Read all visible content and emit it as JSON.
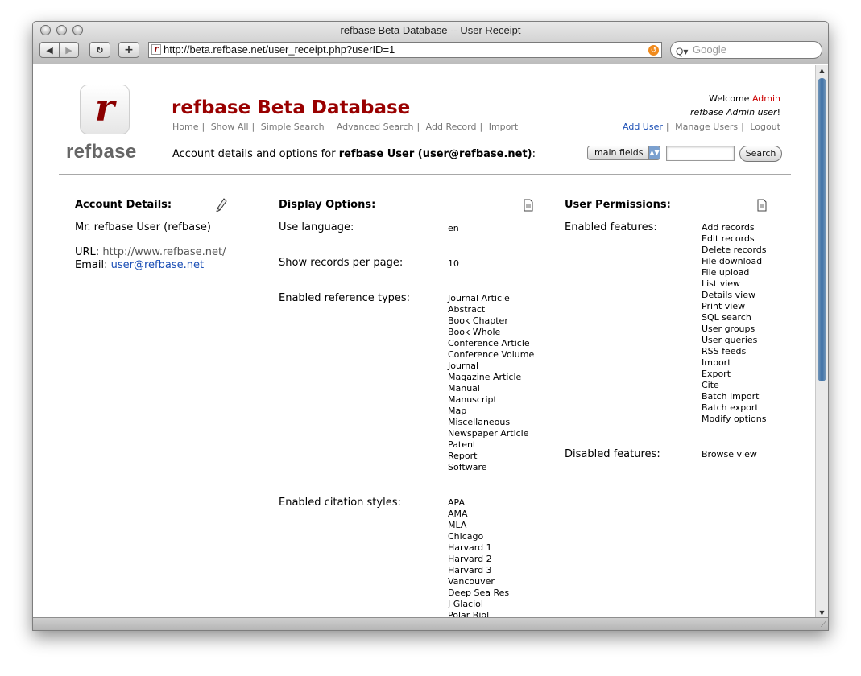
{
  "window": {
    "title": "refbase Beta Database -- User Receipt",
    "url": "http://beta.refbase.net/user_receipt.php?userID=1",
    "search_placeholder": "Google"
  },
  "header": {
    "logo_word": "refbase",
    "site_title": "refbase Beta Database",
    "nav": [
      "Home",
      "Show All",
      "Simple Search",
      "Advanced Search",
      "Add Record",
      "Import"
    ],
    "account_prefix": "Account details and options for ",
    "account_user": "refbase User (user@refbase.net)",
    "account_suffix": ":",
    "welcome_prefix": "Welcome ",
    "welcome_name": "Admin",
    "user_role": "refbase Admin user",
    "user_role_suffix": "!",
    "admin_nav": [
      "Add User",
      "Manage Users",
      "Logout"
    ],
    "search_field_select": "main fields",
    "search_button": "Search"
  },
  "account": {
    "heading": "Account Details:",
    "name": "Mr. refbase User (refbase)",
    "url_label": "URL:",
    "url_value": "http://www.refbase.net/",
    "email_label": "Email:",
    "email_value": "user@refbase.net"
  },
  "display": {
    "heading": "Display Options:",
    "language_label": "Use language:",
    "language_value": "en",
    "records_label": "Show records per page:",
    "records_value": "10",
    "ref_types_label": "Enabled reference types:",
    "ref_types": [
      "Journal Article",
      "Abstract",
      "Book Chapter",
      "Book Whole",
      "Conference Article",
      "Conference Volume",
      "Journal",
      "Magazine Article",
      "Manual",
      "Manuscript",
      "Map",
      "Miscellaneous",
      "Newspaper Article",
      "Patent",
      "Report",
      "Software"
    ],
    "citation_label": "Enabled citation styles:",
    "citation_styles": [
      "APA",
      "AMA",
      "MLA",
      "Chicago",
      "Harvard 1",
      "Harvard 2",
      "Harvard 3",
      "Vancouver",
      "Deep Sea Res",
      "J Glaciol",
      "Polar Biol"
    ]
  },
  "permissions": {
    "heading": "User Permissions:",
    "enabled_label": "Enabled features:",
    "enabled": [
      "Add records",
      "Edit records",
      "Delete records",
      "File download",
      "File upload",
      "List view",
      "Details view",
      "Print view",
      "SQL search",
      "User groups",
      "User queries",
      "RSS feeds",
      "Import",
      "Export",
      "Cite",
      "Batch import",
      "Batch export",
      "Modify options"
    ],
    "disabled_label": "Disabled features:",
    "disabled": [
      "Browse view"
    ]
  }
}
